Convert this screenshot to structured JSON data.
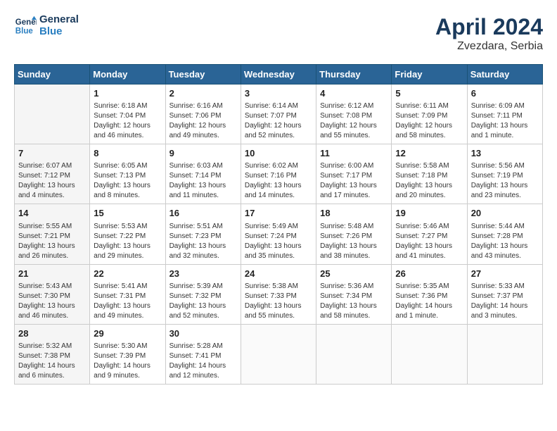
{
  "header": {
    "logo_line1": "General",
    "logo_line2": "Blue",
    "month": "April 2024",
    "location": "Zvezdara, Serbia"
  },
  "weekdays": [
    "Sunday",
    "Monday",
    "Tuesday",
    "Wednesday",
    "Thursday",
    "Friday",
    "Saturday"
  ],
  "weeks": [
    [
      {
        "day": "",
        "info": ""
      },
      {
        "day": "1",
        "info": "Sunrise: 6:18 AM\nSunset: 7:04 PM\nDaylight: 12 hours\nand 46 minutes."
      },
      {
        "day": "2",
        "info": "Sunrise: 6:16 AM\nSunset: 7:06 PM\nDaylight: 12 hours\nand 49 minutes."
      },
      {
        "day": "3",
        "info": "Sunrise: 6:14 AM\nSunset: 7:07 PM\nDaylight: 12 hours\nand 52 minutes."
      },
      {
        "day": "4",
        "info": "Sunrise: 6:12 AM\nSunset: 7:08 PM\nDaylight: 12 hours\nand 55 minutes."
      },
      {
        "day": "5",
        "info": "Sunrise: 6:11 AM\nSunset: 7:09 PM\nDaylight: 12 hours\nand 58 minutes."
      },
      {
        "day": "6",
        "info": "Sunrise: 6:09 AM\nSunset: 7:11 PM\nDaylight: 13 hours\nand 1 minute."
      }
    ],
    [
      {
        "day": "7",
        "info": "Sunrise: 6:07 AM\nSunset: 7:12 PM\nDaylight: 13 hours\nand 4 minutes."
      },
      {
        "day": "8",
        "info": "Sunrise: 6:05 AM\nSunset: 7:13 PM\nDaylight: 13 hours\nand 8 minutes."
      },
      {
        "day": "9",
        "info": "Sunrise: 6:03 AM\nSunset: 7:14 PM\nDaylight: 13 hours\nand 11 minutes."
      },
      {
        "day": "10",
        "info": "Sunrise: 6:02 AM\nSunset: 7:16 PM\nDaylight: 13 hours\nand 14 minutes."
      },
      {
        "day": "11",
        "info": "Sunrise: 6:00 AM\nSunset: 7:17 PM\nDaylight: 13 hours\nand 17 minutes."
      },
      {
        "day": "12",
        "info": "Sunrise: 5:58 AM\nSunset: 7:18 PM\nDaylight: 13 hours\nand 20 minutes."
      },
      {
        "day": "13",
        "info": "Sunrise: 5:56 AM\nSunset: 7:19 PM\nDaylight: 13 hours\nand 23 minutes."
      }
    ],
    [
      {
        "day": "14",
        "info": "Sunrise: 5:55 AM\nSunset: 7:21 PM\nDaylight: 13 hours\nand 26 minutes."
      },
      {
        "day": "15",
        "info": "Sunrise: 5:53 AM\nSunset: 7:22 PM\nDaylight: 13 hours\nand 29 minutes."
      },
      {
        "day": "16",
        "info": "Sunrise: 5:51 AM\nSunset: 7:23 PM\nDaylight: 13 hours\nand 32 minutes."
      },
      {
        "day": "17",
        "info": "Sunrise: 5:49 AM\nSunset: 7:24 PM\nDaylight: 13 hours\nand 35 minutes."
      },
      {
        "day": "18",
        "info": "Sunrise: 5:48 AM\nSunset: 7:26 PM\nDaylight: 13 hours\nand 38 minutes."
      },
      {
        "day": "19",
        "info": "Sunrise: 5:46 AM\nSunset: 7:27 PM\nDaylight: 13 hours\nand 41 minutes."
      },
      {
        "day": "20",
        "info": "Sunrise: 5:44 AM\nSunset: 7:28 PM\nDaylight: 13 hours\nand 43 minutes."
      }
    ],
    [
      {
        "day": "21",
        "info": "Sunrise: 5:43 AM\nSunset: 7:30 PM\nDaylight: 13 hours\nand 46 minutes."
      },
      {
        "day": "22",
        "info": "Sunrise: 5:41 AM\nSunset: 7:31 PM\nDaylight: 13 hours\nand 49 minutes."
      },
      {
        "day": "23",
        "info": "Sunrise: 5:39 AM\nSunset: 7:32 PM\nDaylight: 13 hours\nand 52 minutes."
      },
      {
        "day": "24",
        "info": "Sunrise: 5:38 AM\nSunset: 7:33 PM\nDaylight: 13 hours\nand 55 minutes."
      },
      {
        "day": "25",
        "info": "Sunrise: 5:36 AM\nSunset: 7:34 PM\nDaylight: 13 hours\nand 58 minutes."
      },
      {
        "day": "26",
        "info": "Sunrise: 5:35 AM\nSunset: 7:36 PM\nDaylight: 14 hours\nand 1 minute."
      },
      {
        "day": "27",
        "info": "Sunrise: 5:33 AM\nSunset: 7:37 PM\nDaylight: 14 hours\nand 3 minutes."
      }
    ],
    [
      {
        "day": "28",
        "info": "Sunrise: 5:32 AM\nSunset: 7:38 PM\nDaylight: 14 hours\nand 6 minutes."
      },
      {
        "day": "29",
        "info": "Sunrise: 5:30 AM\nSunset: 7:39 PM\nDaylight: 14 hours\nand 9 minutes."
      },
      {
        "day": "30",
        "info": "Sunrise: 5:28 AM\nSunset: 7:41 PM\nDaylight: 14 hours\nand 12 minutes."
      },
      {
        "day": "",
        "info": ""
      },
      {
        "day": "",
        "info": ""
      },
      {
        "day": "",
        "info": ""
      },
      {
        "day": "",
        "info": ""
      }
    ]
  ]
}
